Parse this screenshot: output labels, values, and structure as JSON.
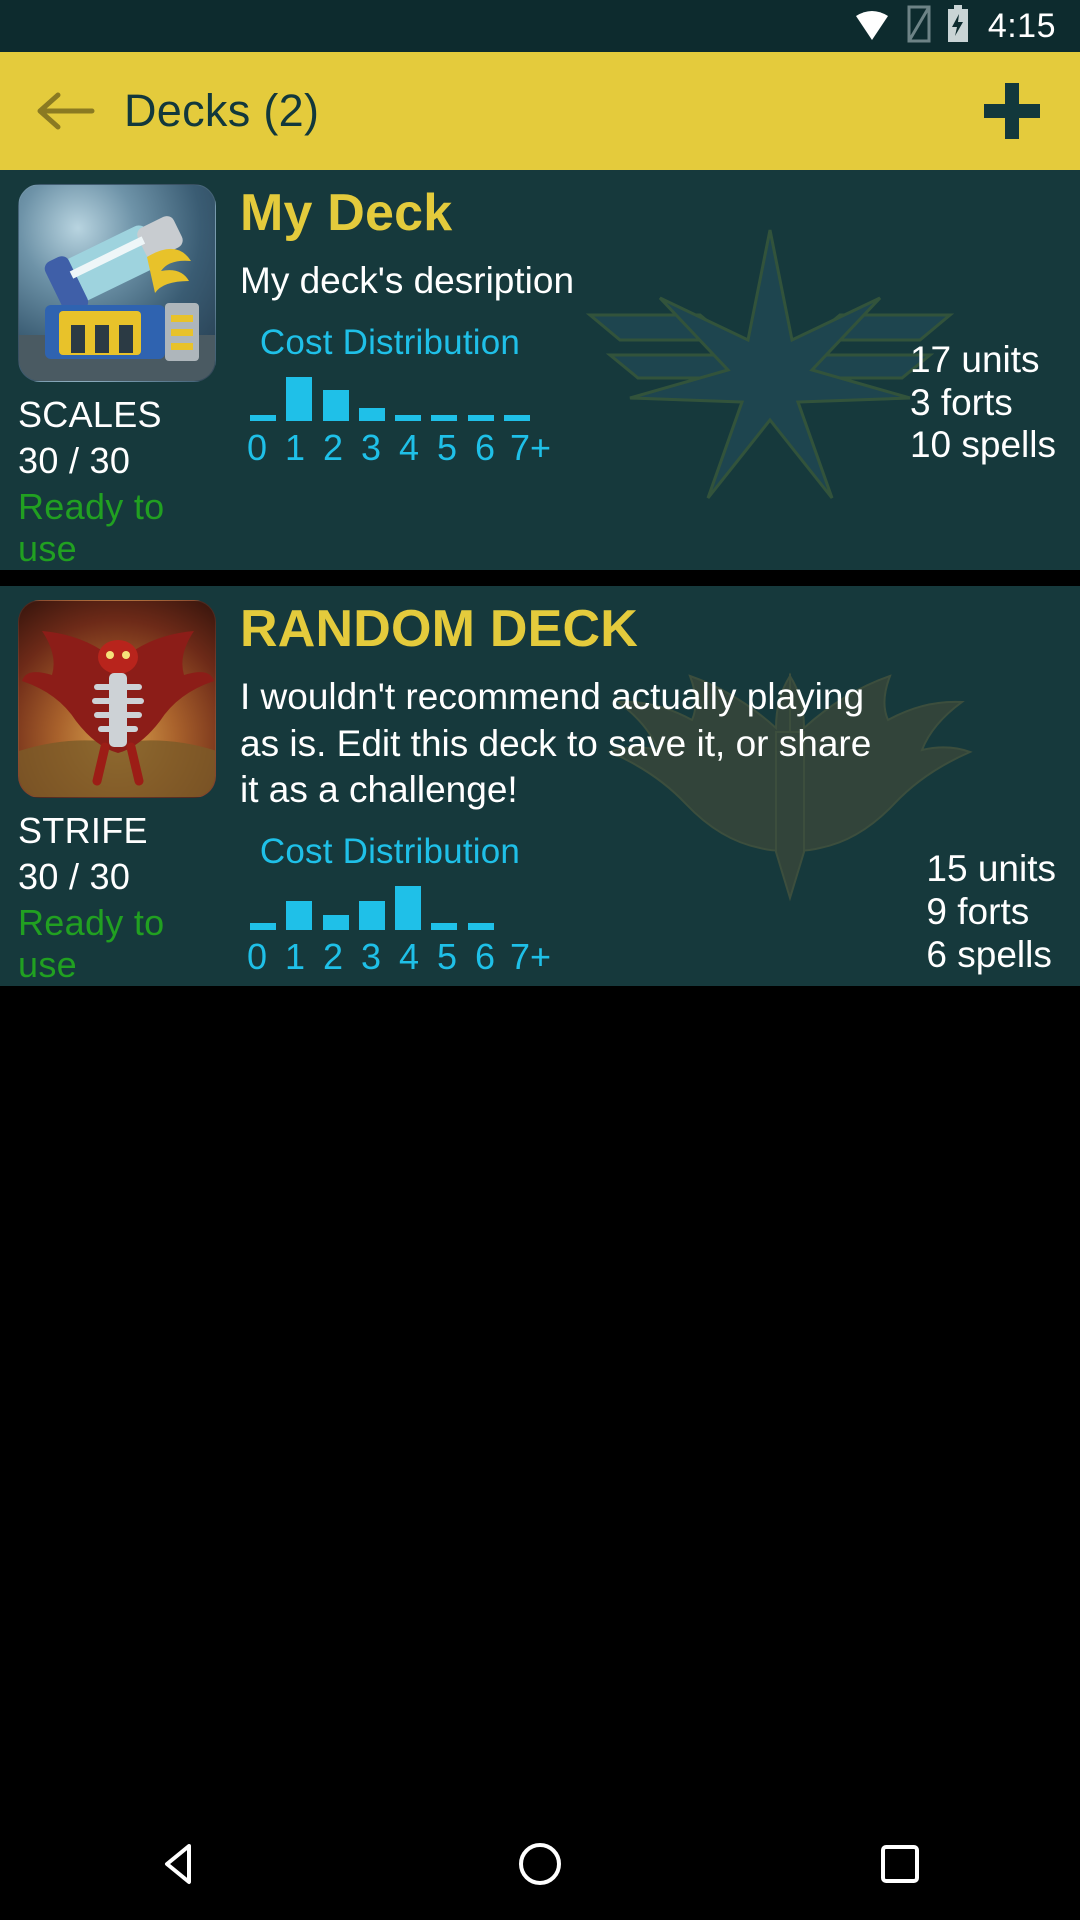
{
  "statusbar": {
    "time": "4:15",
    "icons": [
      "wifi-icon",
      "sim-card-icon",
      "battery-charging-icon"
    ]
  },
  "appbar": {
    "back_label": "back-arrow",
    "title": "Decks (2)",
    "add_label": "+"
  },
  "colors": {
    "accent_yellow": "#e4cb3c",
    "card_bg": "#16393c",
    "status_bar_bg": "#0d2b2e",
    "cyan": "#1fc0e8",
    "ready_green": "#21a021",
    "white": "#ffffff"
  },
  "decks": [
    {
      "title": "My Deck",
      "description": "My deck's desription",
      "faction": "SCALES",
      "count": "30 / 30",
      "status": "Ready to use",
      "thumbnail": "scales-artillery-thumbnail",
      "emblem": "winged-star-emblem",
      "chart_label": "Cost Distribution",
      "stats": [
        "17 units",
        "3 forts",
        "10 spells"
      ],
      "chart_data": {
        "type": "bar",
        "title": "Cost Distribution",
        "categories": [
          "0",
          "1",
          "2",
          "3",
          "4",
          "5",
          "6",
          "7+"
        ],
        "values": [
          1,
          7,
          5,
          2,
          1,
          1,
          1,
          1
        ],
        "xlabel": "",
        "ylabel": "",
        "ylim": [
          0,
          7
        ],
        "grid": false,
        "legend": "none"
      }
    },
    {
      "title": "RANDOM DECK",
      "description": "I wouldn't recommend actually playing as is. Edit this deck to save it, or share it as a challenge!",
      "faction": "STRIFE",
      "count": "30 / 30",
      "status": "Ready to use",
      "thumbnail": "strife-dragon-thumbnail",
      "emblem": "dragon-wings-emblem",
      "chart_label": "Cost Distribution",
      "stats": [
        "15 units",
        "9 forts",
        "6 spells"
      ],
      "chart_data": {
        "type": "bar",
        "title": "Cost Distribution",
        "categories": [
          "0",
          "1",
          "2",
          "3",
          "4",
          "5",
          "6",
          "7+"
        ],
        "values": [
          1,
          4,
          2,
          4,
          6,
          1,
          1,
          0
        ],
        "xlabel": "",
        "ylabel": "",
        "ylim": [
          0,
          6
        ],
        "grid": false,
        "legend": "none"
      }
    }
  ],
  "navbar": {
    "back": "nav-back-triangle",
    "home": "nav-home-circle",
    "recents": "nav-recents-square"
  }
}
